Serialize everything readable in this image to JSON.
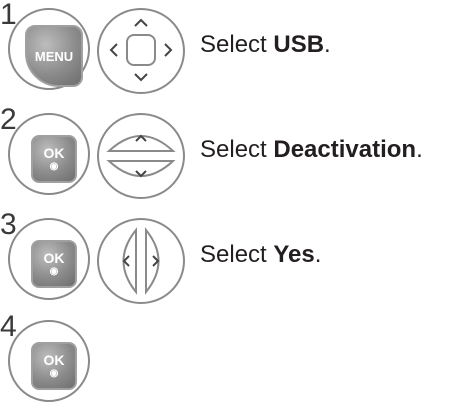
{
  "steps": [
    {
      "number": "1",
      "key_label": "MENU",
      "caption_prefix": "Select ",
      "caption_bold": "USB",
      "caption_suffix": "."
    },
    {
      "number": "2",
      "key_label": "OK",
      "caption_prefix": "Select ",
      "caption_bold": "Deactivation",
      "caption_suffix": "."
    },
    {
      "number": "3",
      "key_label": "OK",
      "caption_prefix": "Select ",
      "caption_bold": "Yes",
      "caption_suffix": "."
    },
    {
      "number": "4",
      "key_label": "OK"
    }
  ],
  "icons": {
    "step1_nav": "four-way-navigation-pad-icon",
    "step2_nav": "up-down-navigation-icon",
    "step3_nav": "left-right-navigation-icon"
  },
  "colors": {
    "button_gray": "#8c8c8c",
    "ring": "#8a8a8a",
    "text": "#231f20"
  }
}
